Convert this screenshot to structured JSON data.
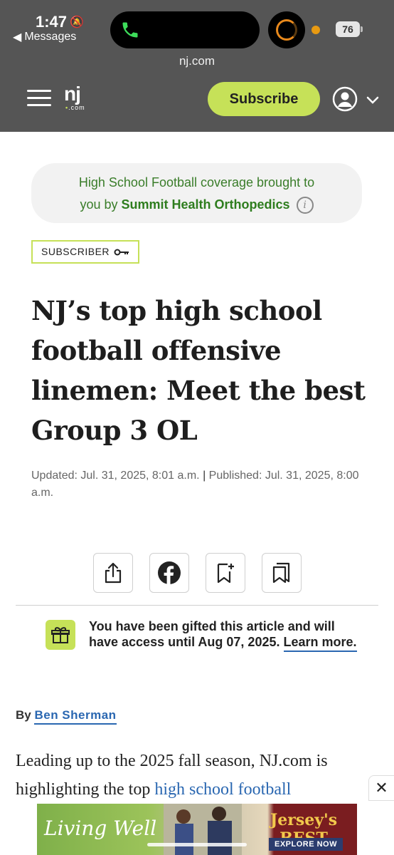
{
  "status_bar": {
    "time": "1:47",
    "back_app": "Messages",
    "battery": "76"
  },
  "browser": {
    "url": "nj.com"
  },
  "header": {
    "logo_main": "nj",
    "logo_sub": ".com",
    "subscribe_label": "Subscribe"
  },
  "sponsor": {
    "line1": "High School Football coverage brought to",
    "line2_prefix": "you by",
    "sponsor_name": "Summit Health Orthopedics",
    "info_symbol": "i"
  },
  "article": {
    "badge": "SUBSCRIBER",
    "headline": "NJ’s top high school football offensive linemen: Meet the best Group 3 OL",
    "updated": "Updated: Jul. 31, 2025, 8:01 a.m.",
    "separator": "|",
    "published": "Published: Jul. 31, 2025, 8:00 a.m."
  },
  "gift": {
    "message": "You have been gifted this article and will have access until Aug 07, 2025.",
    "link": "Learn more."
  },
  "byline": {
    "prefix": "By",
    "author": "Ben Sherman"
  },
  "body": {
    "text_start": "Leading up to the 2025 fall season, NJ.com is highlighting the top ",
    "link": "high school football"
  },
  "ad": {
    "left_text": "Living Well",
    "right_text": "Jersey's BEST",
    "cta": "EXPLORE NOW",
    "close": "✕"
  },
  "colors": {
    "chrome": "#555555",
    "accent": "#c6e158",
    "link": "#2a67b1",
    "sponsor_green": "#2e7d1e"
  }
}
